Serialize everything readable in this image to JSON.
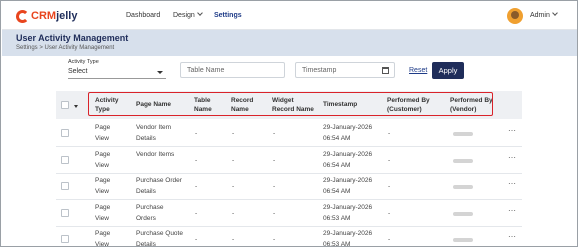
{
  "brand": {
    "name_part1": "CRM",
    "name_part2": "jelly"
  },
  "nav": {
    "dashboard": "Dashboard",
    "design": "Design",
    "settings": "Settings"
  },
  "user": {
    "name": "Admin"
  },
  "page": {
    "title": "User Activity Management",
    "breadcrumb": "Settings  >  User Activity Management"
  },
  "filters": {
    "activity_type_label": "Activity Type",
    "activity_type_value": "Select",
    "table_name_placeholder": "Table Name",
    "timestamp_placeholder": "Timestamp",
    "reset_label": "Reset",
    "apply_label": "Apply"
  },
  "table": {
    "headers": {
      "activity_type": [
        "Activity",
        "Type"
      ],
      "page_name": "Page Name",
      "table_name": [
        "Table",
        "Name"
      ],
      "record_name": [
        "Record",
        "Name"
      ],
      "widget_record_name": [
        "Widget",
        "Record Name"
      ],
      "timestamp": "Timestamp",
      "performed_by_customer": [
        "Performed By",
        "(Customer)"
      ],
      "performed_by_vendor": [
        "Performed By",
        "(Vendor)"
      ]
    },
    "rows": [
      {
        "type": [
          "Page",
          "View"
        ],
        "page": [
          "Vendor Item",
          "Details"
        ],
        "table": "-",
        "record": "-",
        "widget": "-",
        "ts": [
          "29-January-2026",
          "06:54 AM"
        ],
        "customer": "-"
      },
      {
        "type": [
          "Page",
          "View"
        ],
        "page": [
          "Vendor Items",
          ""
        ],
        "table": "-",
        "record": "-",
        "widget": "-",
        "ts": [
          "29-January-2026",
          "06:54 AM"
        ],
        "customer": "-"
      },
      {
        "type": [
          "Page",
          "View"
        ],
        "page": [
          "Purchase Order",
          "Details"
        ],
        "table": "-",
        "record": "-",
        "widget": "-",
        "ts": [
          "29-January-2026",
          "06:54 AM"
        ],
        "customer": "-"
      },
      {
        "type": [
          "Page",
          "View"
        ],
        "page": [
          "Purchase",
          "Orders"
        ],
        "table": "-",
        "record": "-",
        "widget": "-",
        "ts": [
          "29-January-2026",
          "06:53 AM"
        ],
        "customer": "-"
      },
      {
        "type": [
          "Page",
          "View"
        ],
        "page": [
          "Purchase Quote",
          "Details"
        ],
        "table": "-",
        "record": "-",
        "widget": "-",
        "ts": [
          "29-January-2026",
          "06:53 AM"
        ],
        "customer": "-"
      }
    ],
    "more_label": "⋯"
  },
  "colors": {
    "brand_orange": "#e8451e",
    "navy": "#1f2d5a",
    "highlight": "#d9232a"
  }
}
